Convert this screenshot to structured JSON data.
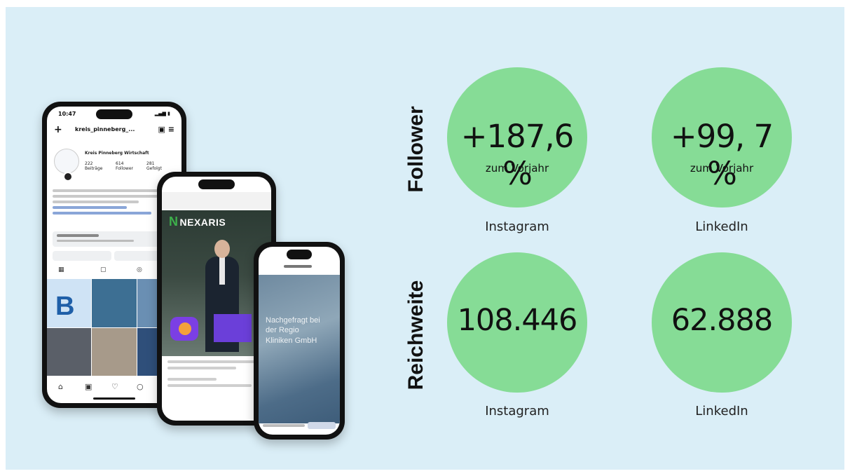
{
  "rows": [
    {
      "label": "Follower",
      "items": [
        {
          "value": "+187,6 %",
          "sub": "zum Vorjahr",
          "platform": "Instagram"
        },
        {
          "value": "+99, 7 %",
          "sub": "zum Vorjahr",
          "platform": "LinkedIn"
        }
      ]
    },
    {
      "label": "Reichweite",
      "items": [
        {
          "value": "108.446",
          "platform": "Instagram"
        },
        {
          "value": "62.888",
          "platform": "LinkedIn"
        }
      ]
    }
  ],
  "phones": {
    "instagram": {
      "time": "10:47",
      "username": "kreis_pinneberg_...",
      "profile_name": "Kreis Pinneberg Wirtschaft",
      "stats": [
        {
          "num": "222",
          "label": "Beiträge"
        },
        {
          "num": "614",
          "label": "Follower"
        },
        {
          "num": "281",
          "label": "Gefolgt"
        }
      ],
      "tile_letter": "B"
    },
    "nexaris": {
      "logo": "NEXARIS"
    },
    "linkedin": {
      "story_text": "Nachgefragt bei der Regio Kliniken GmbH"
    }
  },
  "colors": {
    "background": "#daeef7",
    "circle": "#86dc96"
  }
}
